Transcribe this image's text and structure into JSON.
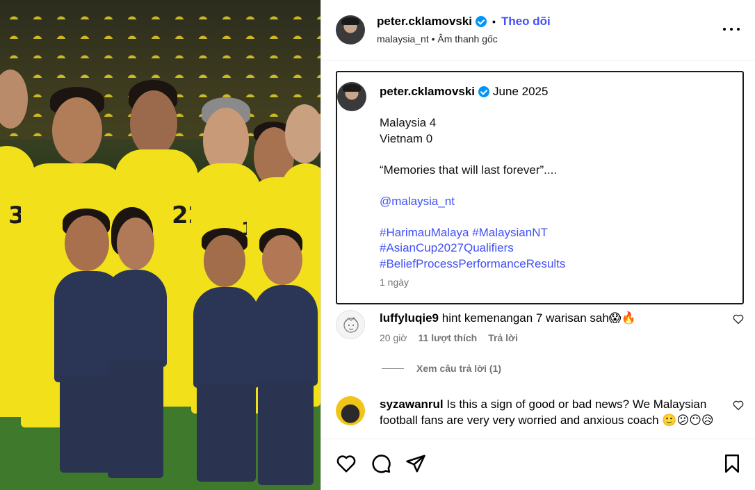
{
  "post": {
    "username": "peter.cklamovski",
    "follow_label": "Theo dõi",
    "separator": "•",
    "subline": "malaysia_nt • Âm thanh gốc"
  },
  "caption": {
    "username": "peter.cklamovski",
    "date": "June 2025",
    "lines": [
      "Malaysia 4",
      "Vietnam 0",
      "",
      "“Memories that will last forever”....",
      "",
      "@malaysia_nt",
      "",
      "#HarimauMalaya #MalaysianNT",
      "#AsianCup2027Qualifiers",
      "#BeliefProcessPerformanceResults"
    ],
    "time": "1 ngày"
  },
  "comments": [
    {
      "username": "luffyluqie9",
      "text": "hint kemenangan 7 warisan sah😱🔥",
      "time": "20 giờ",
      "likes": "11 lượt thích",
      "reply": "Trả lời",
      "view_replies": "Xem câu trả lời (1)"
    },
    {
      "username": "syzawanrul",
      "text": "Is this a sign of good or bad news? We Malaysian football fans are very very worried and anxious coach 🙂😕😶😥"
    }
  ],
  "photo": {
    "jersey_numbers": [
      "3",
      "22",
      "18"
    ]
  },
  "colors": {
    "link": "#4150f7",
    "verified": "#0095f6",
    "jersey": "#f1e01a",
    "kids_kit": "#2b3556"
  }
}
